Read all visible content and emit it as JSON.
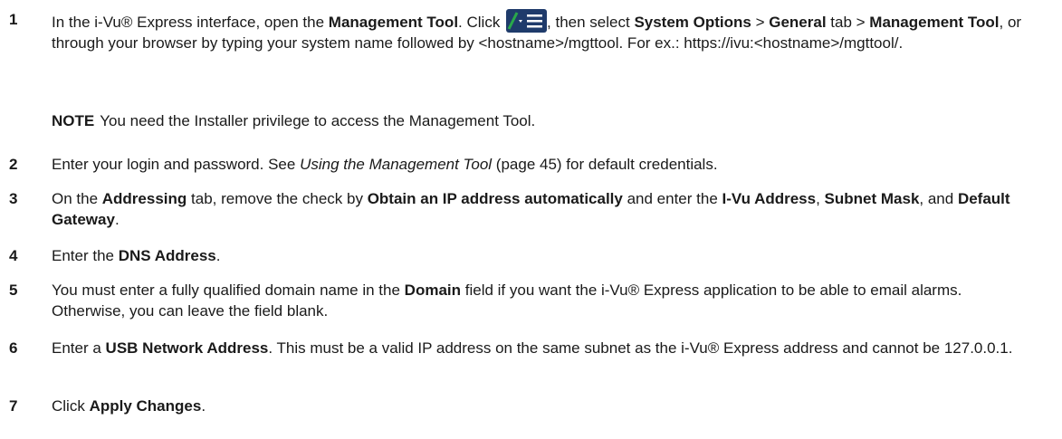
{
  "steps": [
    {
      "number": "1",
      "parts": {
        "p1": "In the i-Vu® Express interface, open the ",
        "b1": "Management Tool",
        "p2": ". Click ",
        "p3": ", then select ",
        "b2": "System Options",
        "p4": " > ",
        "b3": "General",
        "p5": " tab > ",
        "b4": "Management Tool",
        "p6": ", or through your browser by typing your system name followed by <hostname>/mgttool. For ex.: https://ivu:<hostname>/mgttool/."
      }
    },
    {
      "note_label": "NOTE",
      "note_text": "You need the Installer privilege to access the Management Tool."
    },
    {
      "number": "2",
      "parts": {
        "p1": "Enter your login and password. See ",
        "i1": "Using the Management Tool",
        "p2": " (page 45) for default credentials."
      }
    },
    {
      "number": "3",
      "parts": {
        "p1": "On the ",
        "b1": "Addressing",
        "p2": " tab, remove the check by ",
        "b2": "Obtain an IP address automatically",
        "p3": " and enter the ",
        "b3": "I-Vu Address",
        "p4": ", ",
        "b4": "Subnet Mask",
        "p5": ", and ",
        "b5": "Default Gateway",
        "p6": "."
      }
    },
    {
      "number": "4",
      "parts": {
        "p1": "Enter the ",
        "b1": "DNS Address",
        "p2": "."
      }
    },
    {
      "number": "5",
      "parts": {
        "p1": "You must enter a fully qualified domain name in the ",
        "b1": "Domain",
        "p2": " field if you want the i-Vu® Express application to be able to email alarms. Otherwise, you can leave the field blank."
      }
    },
    {
      "number": "6",
      "parts": {
        "p1": "Enter a ",
        "b1": "USB Network Address",
        "p2": ". This must be a valid IP address on the same subnet as the i-Vu® Express address and cannot be 127.0.0.1."
      }
    },
    {
      "number": "7",
      "parts": {
        "p1": "Click ",
        "b1": "Apply Changes",
        "p2": "."
      }
    }
  ],
  "icons": {
    "step1_button": "management-tool-icon"
  },
  "colors": {
    "icon_bg": "#1f3b6b",
    "icon_accent": "#2aa84a",
    "text": "#1a1a1a"
  }
}
